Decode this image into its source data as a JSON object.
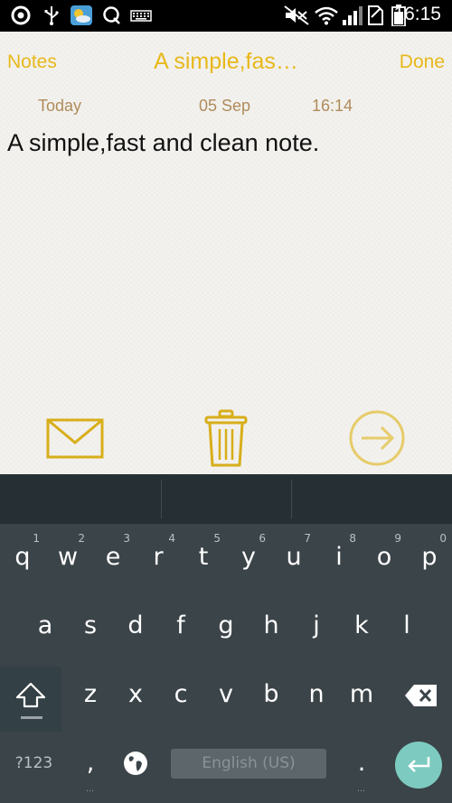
{
  "status_bar": {
    "time": "16:15",
    "left_icons": [
      "sync-icon",
      "usb-icon",
      "weather-icon",
      "search-q-icon",
      "keyboard-icon"
    ],
    "right_icons": [
      "mute-icon",
      "wifi-icon",
      "signal-icon",
      "no-sim-icon",
      "battery-icon"
    ]
  },
  "nav": {
    "back_label": "Notes",
    "title": "A simple,fas…",
    "done_label": "Done"
  },
  "meta": {
    "day": "Today",
    "date": "05 Sep",
    "time": "16:14"
  },
  "note": {
    "text": "A simple,fast and clean note."
  },
  "toolbar": {
    "icons": [
      "mail-icon",
      "trash-icon",
      "send-icon"
    ]
  },
  "colors": {
    "accent": "#e8b81a",
    "meta": "#b08b5c",
    "paper": "#f4f3ef",
    "keyboard_bg": "#3b4449",
    "suggest_bg": "#263034",
    "enter_key": "#7dcbc0"
  },
  "keyboard": {
    "row1": [
      {
        "key": "q",
        "hint": "1"
      },
      {
        "key": "w",
        "hint": "2"
      },
      {
        "key": "e",
        "hint": "3"
      },
      {
        "key": "r",
        "hint": "4"
      },
      {
        "key": "t",
        "hint": "5"
      },
      {
        "key": "y",
        "hint": "6"
      },
      {
        "key": "u",
        "hint": "7"
      },
      {
        "key": "i",
        "hint": "8"
      },
      {
        "key": "o",
        "hint": "9"
      },
      {
        "key": "p",
        "hint": "0"
      }
    ],
    "row2": [
      "a",
      "s",
      "d",
      "f",
      "g",
      "h",
      "j",
      "k",
      "l"
    ],
    "row3": [
      "z",
      "x",
      "c",
      "v",
      "b",
      "n",
      "m"
    ],
    "symbols_label": "?123",
    "comma": ",",
    "period": ".",
    "space_label": "English (US)"
  }
}
